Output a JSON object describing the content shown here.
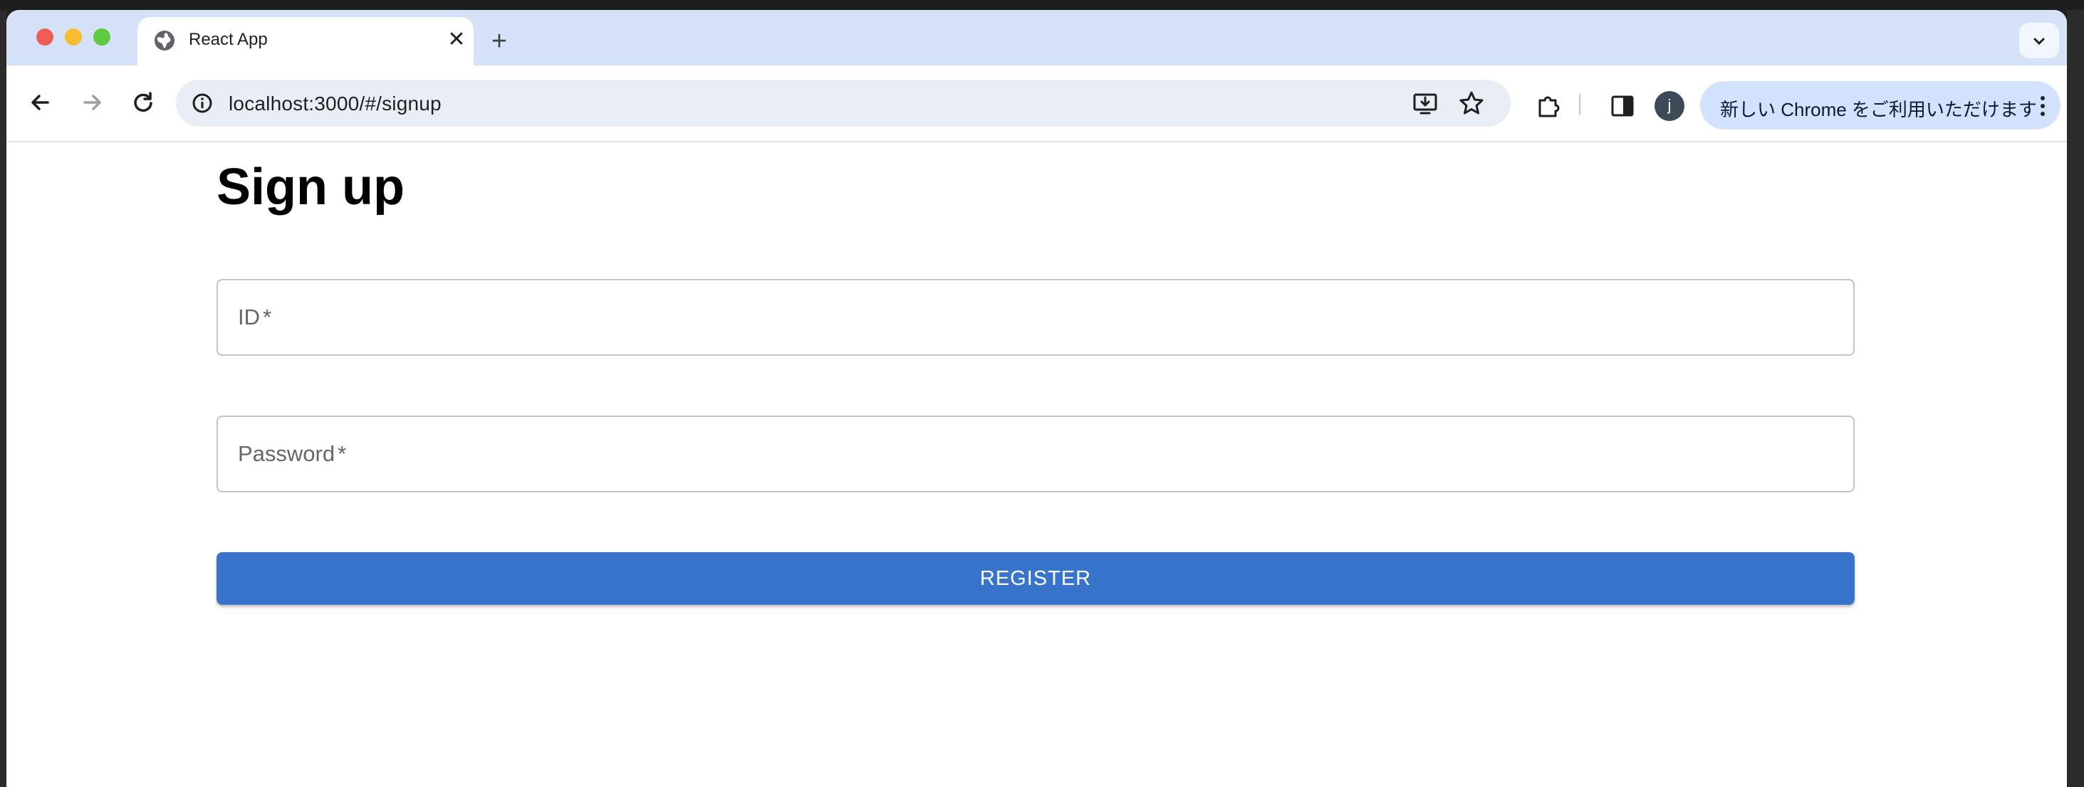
{
  "browser": {
    "tab": {
      "title": "React App",
      "close_glyph": "✕",
      "icon": "globe-icon"
    },
    "new_tab_glyph": "+",
    "address": {
      "url": "localhost:3000/#/signup"
    },
    "update_chip": {
      "label": "新しい Chrome をご利用いただけます"
    },
    "profile": {
      "initial": "j"
    }
  },
  "page": {
    "title": "Sign up",
    "fields": [
      {
        "label": "ID",
        "required_mark": "*"
      },
      {
        "label": "Password",
        "required_mark": "*"
      }
    ],
    "register_label": "REGISTER"
  },
  "colors": {
    "primary_button": "#3874cb",
    "tabstrip": "#d6e2f8",
    "update_chip": "#d3e3fd"
  }
}
